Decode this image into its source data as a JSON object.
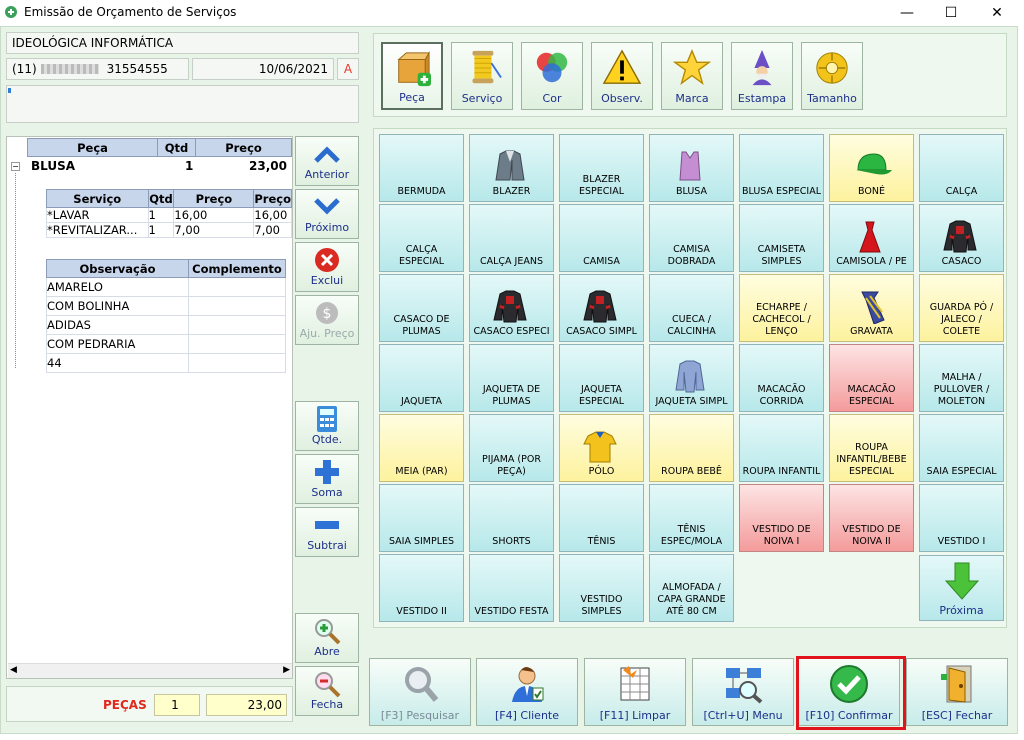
{
  "window": {
    "title": "Emissão de Orçamento de Serviços",
    "min": "—",
    "max": "☐",
    "close": "✕"
  },
  "client": {
    "name": "IDEOLÓGICA INFORMÁTICA",
    "phone_prefix": "(11)",
    "phone_number": "31554555",
    "date": "10/06/2021",
    "flag": "A"
  },
  "toolbar": [
    {
      "label": "Peça",
      "icon": "box-add-icon"
    },
    {
      "label": "Serviço",
      "icon": "thread-spool-icon"
    },
    {
      "label": "Cor",
      "icon": "color-circles-icon"
    },
    {
      "label": "Observ.",
      "icon": "warning-icon"
    },
    {
      "label": "Marca",
      "icon": "star-icon"
    },
    {
      "label": "Estampa",
      "icon": "wizard-icon"
    },
    {
      "label": "Tamanho",
      "icon": "tape-measure-icon"
    }
  ],
  "piece_table": {
    "headers": [
      "Peça",
      "Qtd",
      "Preço"
    ],
    "row": {
      "name": "BLUSA",
      "qty": "1",
      "price": "23,00"
    }
  },
  "service_table": {
    "headers": [
      "Serviço",
      "Qtd",
      "Preço",
      "Preço"
    ],
    "rows": [
      [
        "*LAVAR",
        "1",
        "16,00",
        "16,00"
      ],
      [
        "*REVITALIZAR...",
        "1",
        "7,00",
        "7,00"
      ]
    ]
  },
  "obs_table": {
    "headers": [
      "Observação",
      "Complemento"
    ],
    "rows": [
      "AMARELO",
      "COM BOLINHA",
      "ADIDAS",
      "COM PEDRARIA",
      "44"
    ]
  },
  "side_buttons": {
    "prev": "Anterior",
    "next": "Próximo",
    "delete": "Exclui",
    "price": "Aju. Preço",
    "qty": "Qtde.",
    "add": "Soma",
    "sub": "Subtrai",
    "open": "Abre",
    "close": "Fecha"
  },
  "totals": {
    "label": "PEÇAS",
    "qty": "1",
    "value": "23,00"
  },
  "items": [
    {
      "label": "BERMUDA",
      "c": ""
    },
    {
      "label": "BLAZER",
      "c": "",
      "img": "jacket-grey"
    },
    {
      "label": "BLAZER ESPECIAL",
      "c": ""
    },
    {
      "label": "BLUSA",
      "c": "",
      "img": "blouse"
    },
    {
      "label": "BLUSA ESPECIAL",
      "c": ""
    },
    {
      "label": "BONÉ",
      "c": "y",
      "img": "cap"
    },
    {
      "label": "CALÇA",
      "c": ""
    },
    {
      "label": "CALÇA ESPECIAL",
      "c": ""
    },
    {
      "label": "CALÇA JEANS",
      "c": ""
    },
    {
      "label": "CAMISA",
      "c": ""
    },
    {
      "label": "CAMISA DOBRADA",
      "c": ""
    },
    {
      "label": "CAMISETA SIMPLES",
      "c": ""
    },
    {
      "label": "CAMISOLA / PE",
      "c": "",
      "img": "dress-red"
    },
    {
      "label": "CASACO",
      "c": "",
      "img": "coat"
    },
    {
      "label": "CASACO DE PLUMAS",
      "c": ""
    },
    {
      "label": "CASACO ESPECI",
      "c": "",
      "img": "coat"
    },
    {
      "label": "CASACO SIMPL",
      "c": "",
      "img": "coat"
    },
    {
      "label": "CUECA / CALCINHA",
      "c": ""
    },
    {
      "label": "ECHARPE / CACHECOL / LENÇO",
      "c": "y"
    },
    {
      "label": "GRAVATA",
      "c": "y",
      "img": "tie"
    },
    {
      "label": "GUARDA PÓ / JALECO / COLETE",
      "c": "y"
    },
    {
      "label": "JAQUETA",
      "c": ""
    },
    {
      "label": "JAQUETA DE PLUMAS",
      "c": ""
    },
    {
      "label": "JAQUETA ESPECIAL",
      "c": ""
    },
    {
      "label": "JAQUETA SIMPL",
      "c": "",
      "img": "shirt-blue"
    },
    {
      "label": "MACACÃO CORRIDA",
      "c": ""
    },
    {
      "label": "MACACÃO ESPECIAL",
      "c": "r"
    },
    {
      "label": "MALHA / PULLOVER / MOLETON",
      "c": ""
    },
    {
      "label": "MEIA (PAR)",
      "c": "y"
    },
    {
      "label": "PIJAMA (POR PEÇA)",
      "c": ""
    },
    {
      "label": "PÓLO",
      "c": "y",
      "img": "polo"
    },
    {
      "label": "ROUPA BEBÊ",
      "c": "y"
    },
    {
      "label": "ROUPA INFANTIL",
      "c": ""
    },
    {
      "label": "ROUPA INFANTIL/BEBE ESPECIAL",
      "c": "y"
    },
    {
      "label": "SAIA ESPECIAL",
      "c": ""
    },
    {
      "label": "SAIA SIMPLES",
      "c": ""
    },
    {
      "label": "SHORTS",
      "c": ""
    },
    {
      "label": "TÊNIS",
      "c": ""
    },
    {
      "label": "TÊNIS ESPEC/MOLA",
      "c": ""
    },
    {
      "label": "VESTIDO DE NOIVA I",
      "c": "r"
    },
    {
      "label": "VESTIDO DE NOIVA II",
      "c": "r"
    },
    {
      "label": "VESTIDO I",
      "c": ""
    },
    {
      "label": "VESTIDO II",
      "c": ""
    },
    {
      "label": "VESTIDO FESTA",
      "c": ""
    },
    {
      "label": "VESTIDO SIMPLES",
      "c": ""
    },
    {
      "label": "ALMOFADA / CAPA GRANDE ATÉ 80 CM",
      "c": ""
    }
  ],
  "next_page": "Próxima",
  "bottom": [
    {
      "label": "[F3] Pesquisar",
      "icon": "magnifier-icon"
    },
    {
      "label": "[F4] Cliente",
      "icon": "client-icon"
    },
    {
      "label": "[F11] Limpar",
      "icon": "clear-grid-icon"
    },
    {
      "label": "[Ctrl+U] Menu",
      "icon": "network-search-icon"
    },
    {
      "label": "[F10] Confirmar",
      "icon": "check-icon"
    },
    {
      "label": "[ESC] Fechar",
      "icon": "door-exit-icon"
    }
  ]
}
